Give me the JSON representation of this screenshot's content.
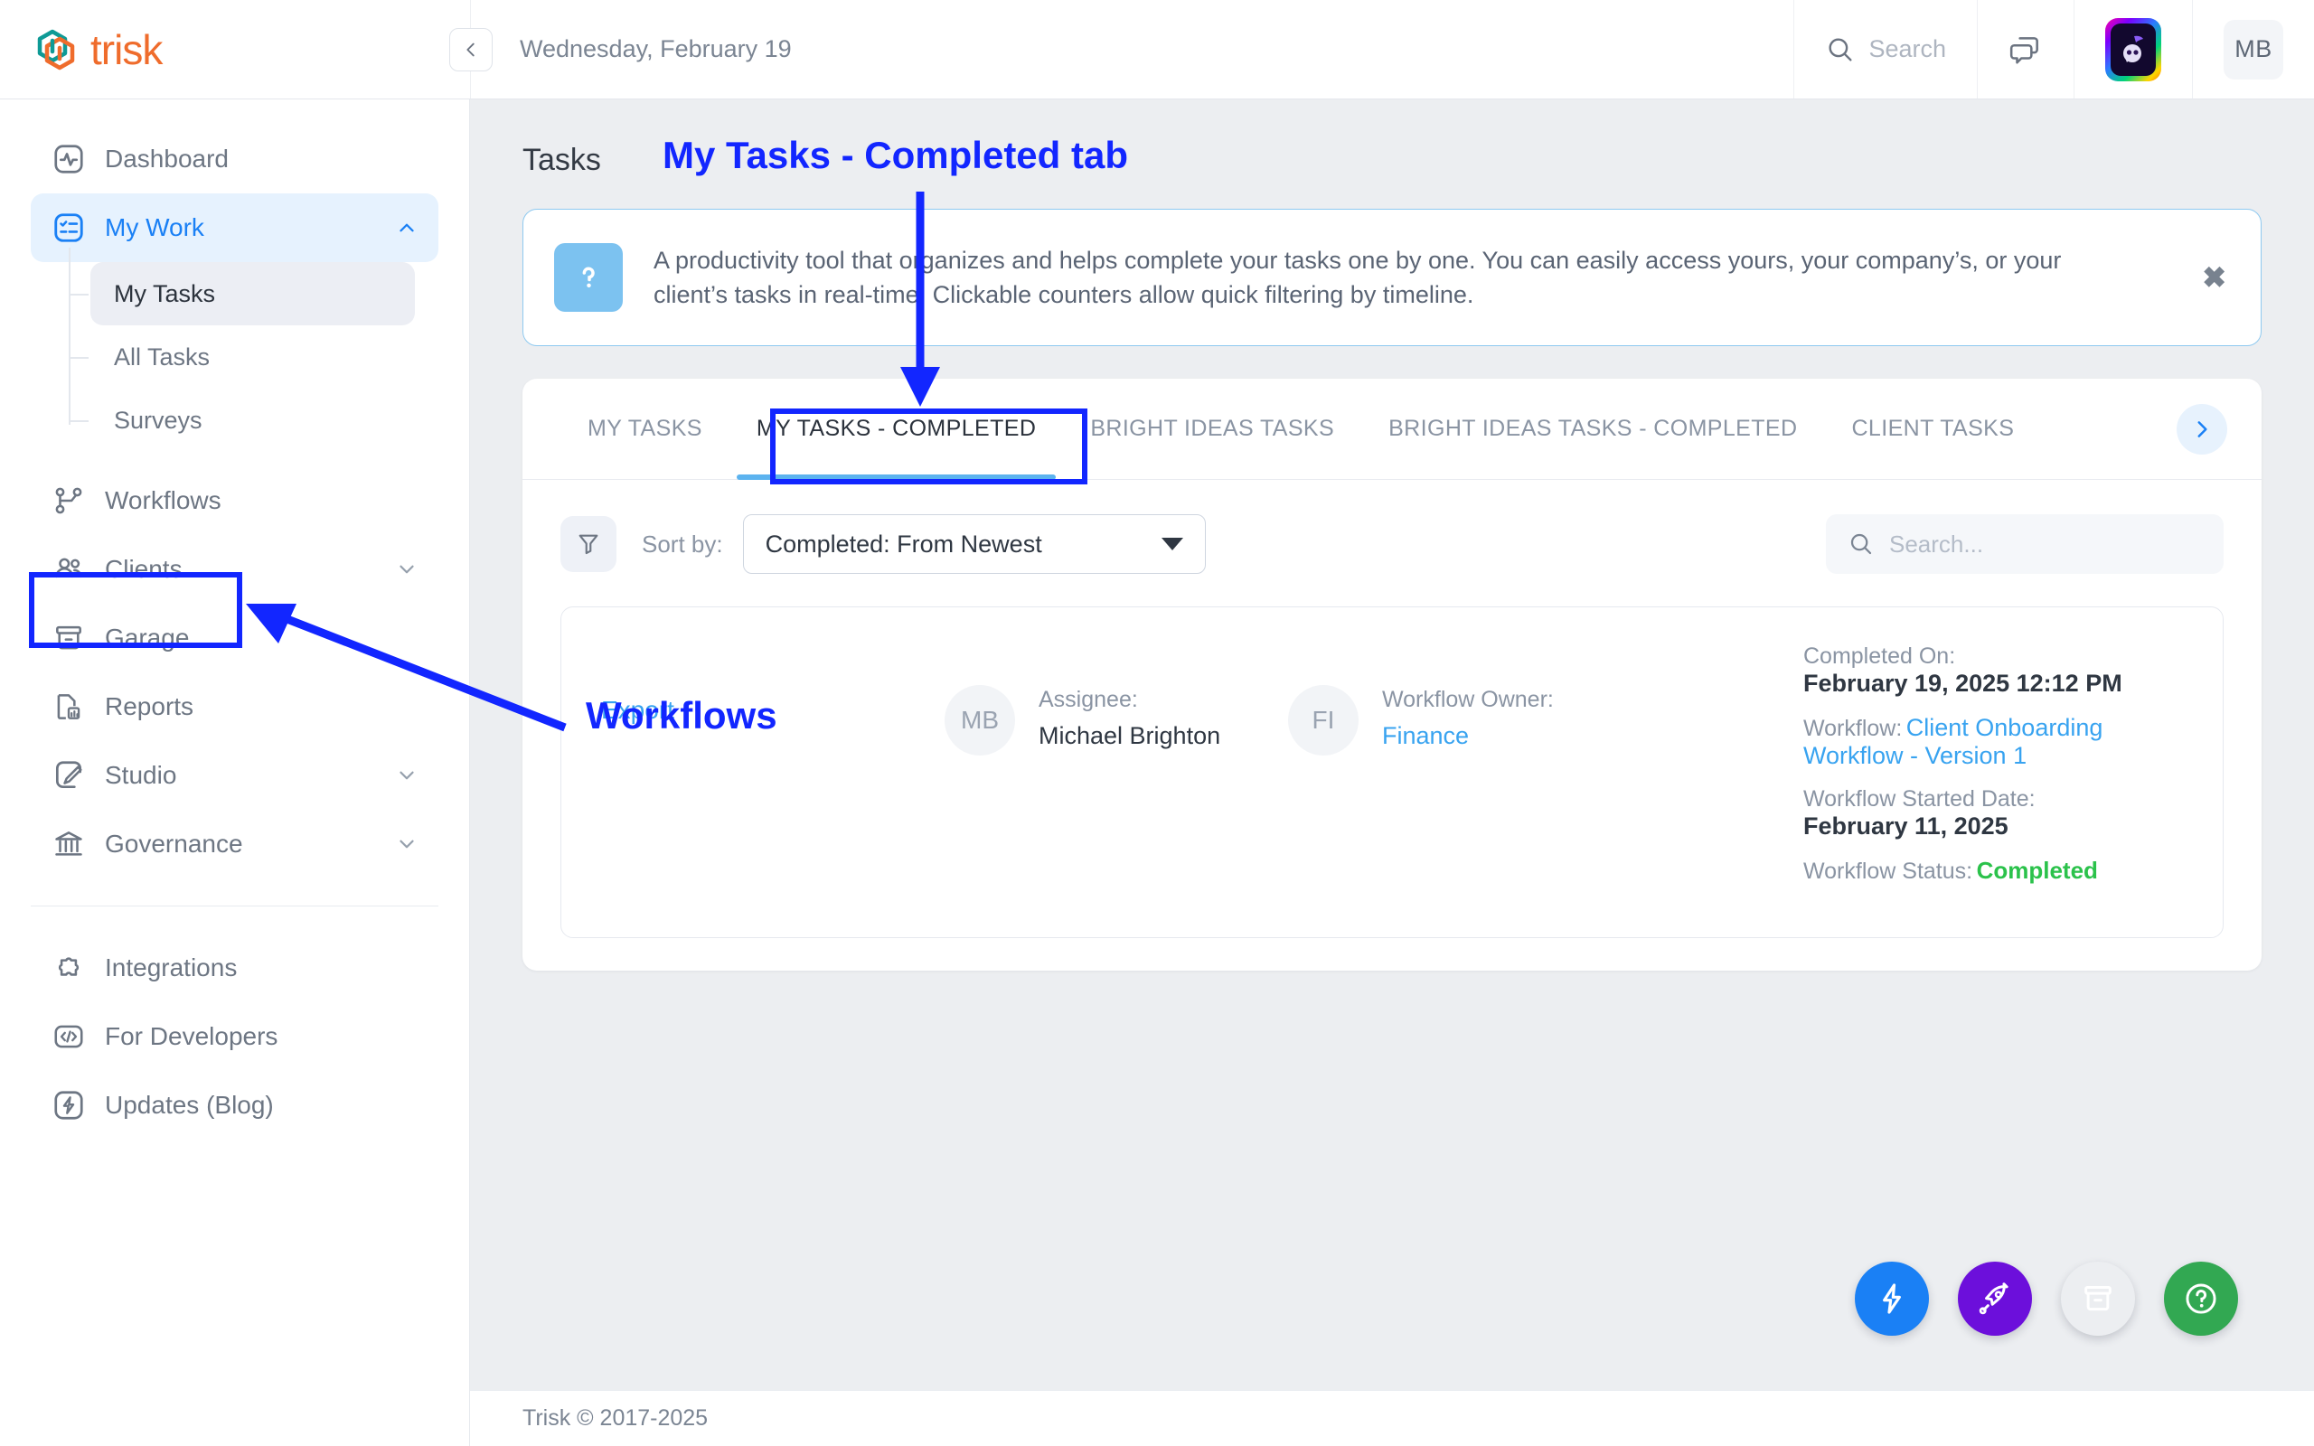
{
  "brand": {
    "name": "trisk",
    "logo_icon": "trisk-hexagon-logo",
    "orange": "#ef6c2c",
    "teal": "#0e9a96"
  },
  "topbar": {
    "collapse_icon": "chevron-left-icon",
    "date": "Wednesday, February 19",
    "search_label": "Search",
    "search_icon": "search-icon",
    "chat_icon": "chat-bubbles-icon",
    "assistant_icon": "ai-assistant-avatar",
    "user_initials": "MB"
  },
  "sidebar": {
    "items": [
      {
        "label": "Dashboard",
        "icon": "activity-square-icon",
        "state": "default",
        "chevron": ""
      },
      {
        "label": "My Work",
        "icon": "checklist-square-icon",
        "state": "active",
        "chevron": "chevron-up-icon"
      },
      {
        "label": "Workflows",
        "icon": "workflow-nodes-icon",
        "state": "default",
        "chevron": ""
      },
      {
        "label": "Clients",
        "icon": "users-icon",
        "state": "default",
        "chevron": "chevron-down-icon"
      },
      {
        "label": "Garage",
        "icon": "archive-box-icon",
        "state": "default",
        "chevron": ""
      },
      {
        "label": "Reports",
        "icon": "document-chart-icon",
        "state": "default",
        "chevron": ""
      },
      {
        "label": "Studio",
        "icon": "brush-square-icon",
        "state": "default",
        "chevron": "chevron-down-icon"
      },
      {
        "label": "Governance",
        "icon": "bank-columns-icon",
        "state": "default",
        "chevron": "chevron-down-icon"
      }
    ],
    "subitems": [
      {
        "label": "My Tasks",
        "state": "selected"
      },
      {
        "label": "All Tasks",
        "state": "default"
      },
      {
        "label": "Surveys",
        "state": "default"
      }
    ],
    "bottom_items": [
      {
        "label": "Integrations",
        "icon": "puzzle-piece-icon"
      },
      {
        "label": "For Developers",
        "icon": "code-brackets-icon"
      },
      {
        "label": "Updates (Blog)",
        "icon": "lightning-bolt-square-icon"
      }
    ]
  },
  "main": {
    "page_title": "Tasks",
    "banner": {
      "icon": "question-mark-icon",
      "text": "A productivity tool that organizes and helps complete your tasks one by one. You can easily access yours, your company’s, or your client’s tasks in real-time. Clickable counters allow quick filtering by timeline.",
      "close_icon": "close-icon"
    },
    "tabs": [
      {
        "label": "MY TASKS",
        "active": false
      },
      {
        "label": "MY TASKS - COMPLETED",
        "active": true
      },
      {
        "label": "BRIGHT IDEAS TASKS",
        "active": false
      },
      {
        "label": "BRIGHT IDEAS TASKS - COMPLETED",
        "active": false
      },
      {
        "label": "CLIENT TASKS",
        "active": false
      }
    ],
    "tabs_next_icon": "chevron-right-icon",
    "toolbar": {
      "filter_icon": "filter-funnel-icon",
      "sort_label": "Sort by:",
      "sort_value": "Completed: From Newest",
      "sort_caret_icon": "caret-down-icon",
      "search_icon": "search-icon",
      "search_placeholder": "Search..."
    },
    "task_card": {
      "export_label": "Export",
      "assignee_avatar": "MB",
      "assignee_label": "Assignee:",
      "assignee_name": "Michael Brighton",
      "owner_avatar": "FI",
      "owner_label": "Workflow Owner:",
      "owner_name": "Finance",
      "completed_on_label": "Completed On:",
      "completed_on_value": "February 19, 2025 12:12 PM",
      "workflow_label": "Workflow:",
      "workflow_value": "Client Onboarding Workflow - Version 1",
      "started_label": "Workflow Started Date:",
      "started_value": "February 11, 2025",
      "status_label": "Workflow Status:",
      "status_value": "Completed",
      "status_color": "#2bc24b"
    },
    "fabs": [
      {
        "icon": "lightning-bolt-icon",
        "color": "#1a80f5"
      },
      {
        "icon": "rocket-icon",
        "color": "#6c0fdb"
      },
      {
        "icon": "archive-box-icon",
        "color": "#f5a košice"
      },
      {
        "icon": "question-circle-icon",
        "color": "#32a852"
      }
    ]
  },
  "footer": {
    "copyright": "Trisk © 2017-2025"
  },
  "annotations": [
    {
      "type": "label",
      "text": "My Tasks - Completed tab",
      "color": "#1226ff"
    },
    {
      "type": "label",
      "text": "Workflows",
      "color": "#1226ff"
    },
    {
      "type": "box",
      "target": "tab-my-tasks-completed",
      "color": "#1226ff"
    },
    {
      "type": "box",
      "target": "sidebar-item-workflows",
      "color": "#1226ff"
    },
    {
      "type": "arrow",
      "from": "label-my-tasks-completed-tab",
      "to": "tab-my-tasks-completed",
      "color": "#1226ff"
    },
    {
      "type": "arrow",
      "from": "label-workflows",
      "to": "sidebar-item-workflows",
      "color": "#1226ff"
    }
  ]
}
